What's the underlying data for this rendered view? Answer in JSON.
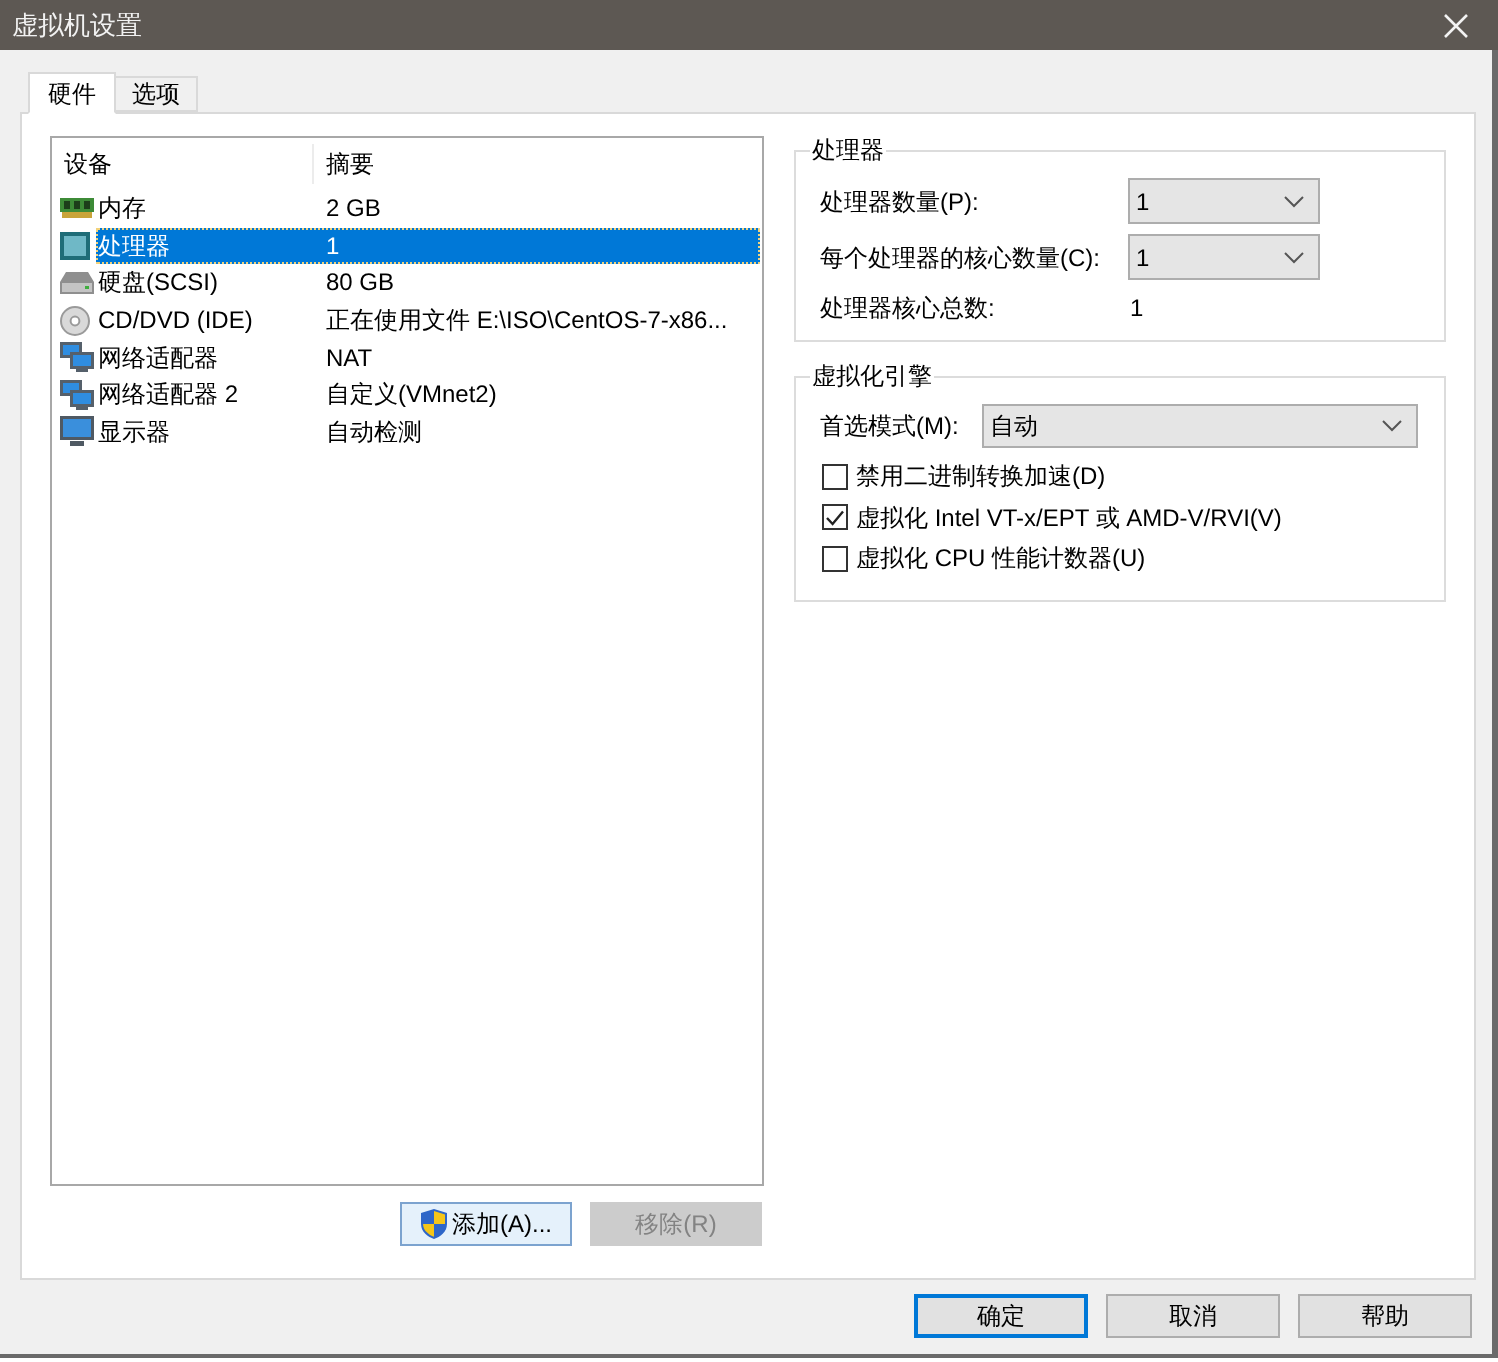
{
  "window": {
    "title": "虚拟机设置"
  },
  "tabs": [
    {
      "label": "硬件",
      "selected": true
    },
    {
      "label": "选项",
      "selected": false
    }
  ],
  "device_table": {
    "columns": [
      "设备",
      "摘要"
    ],
    "rows": [
      {
        "kind": "memory",
        "device": "内存",
        "summary": "2 GB",
        "selected": false
      },
      {
        "kind": "processor",
        "device": "处理器",
        "summary": "1",
        "selected": true
      },
      {
        "kind": "disk",
        "device": "硬盘(SCSI)",
        "summary": "80 GB",
        "selected": false
      },
      {
        "kind": "cd",
        "device": "CD/DVD (IDE)",
        "summary": "正在使用文件 E:\\ISO\\CentOS-7-x86...",
        "selected": false
      },
      {
        "kind": "network",
        "device": "网络适配器",
        "summary": "NAT",
        "selected": false
      },
      {
        "kind": "network",
        "device": "网络适配器 2",
        "summary": "自定义(VMnet2)",
        "selected": false
      },
      {
        "kind": "display",
        "device": "显示器",
        "summary": "自动检测",
        "selected": false
      }
    ]
  },
  "device_buttons": [
    {
      "kind": "elevated",
      "label": "添加(A)...",
      "disabled": false
    },
    {
      "kind": "plain",
      "label": "移除(R)",
      "disabled": true
    }
  ],
  "processor_group": {
    "title": "处理器",
    "fields": [
      {
        "kind": "dropdown",
        "label": "处理器数量(P):",
        "value": "1"
      },
      {
        "kind": "dropdown",
        "label": "每个处理器的核心数量(C):",
        "value": "1"
      },
      {
        "kind": "readout",
        "label": "处理器核心总数:",
        "value": "1"
      }
    ]
  },
  "virtualization_group": {
    "title": "虚拟化引擎",
    "mode": {
      "label": "首选模式(M):",
      "value": "自动"
    },
    "options": [
      {
        "label": "禁用二进制转换加速(D)",
        "checked": false
      },
      {
        "label": "虚拟化 Intel VT-x/EPT 或 AMD-V/RVI(V)",
        "checked": true
      },
      {
        "label": "虚拟化 CPU 性能计数器(U)",
        "checked": false
      }
    ]
  },
  "dialog_buttons": [
    {
      "label": "确定",
      "default": true
    },
    {
      "label": "取消",
      "default": false
    },
    {
      "label": "帮助",
      "default": false
    }
  ]
}
